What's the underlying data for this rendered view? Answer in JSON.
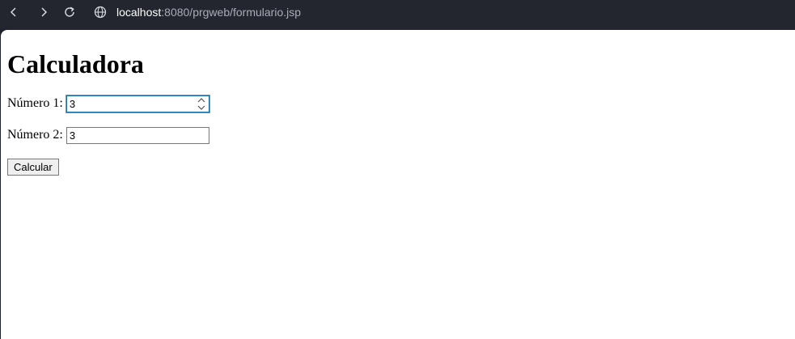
{
  "browser": {
    "url_host": "localhost",
    "url_rest": ":8080/prgweb/formulario.jsp",
    "icons": [
      "back-icon",
      "forward-icon",
      "reload-icon",
      "globe-icon"
    ]
  },
  "page": {
    "title": "Calculadora",
    "field1": {
      "label": "Número 1:",
      "value": "3"
    },
    "field2": {
      "label": "Número 2:",
      "value": "3"
    },
    "submit_label": "Calcular"
  }
}
